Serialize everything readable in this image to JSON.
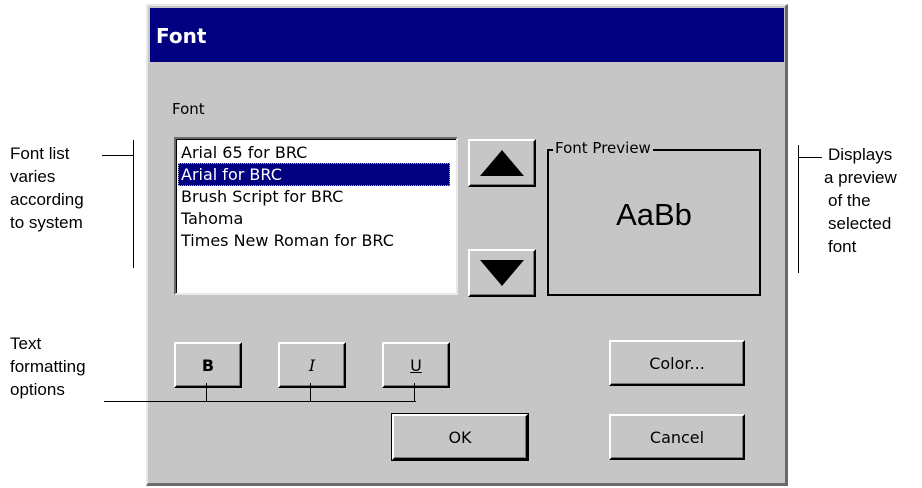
{
  "dialog": {
    "title": "Font",
    "font_label": "Font",
    "font_list": [
      "Arial 65 for BRC",
      "Arial for BRC",
      "Brush Script for BRC",
      "Tahoma",
      "Times New Roman for BRC"
    ],
    "selected_font_index": 1,
    "scroll_up_icon": "triangle-up-icon",
    "scroll_down_icon": "triangle-down-icon",
    "preview_label": "Font Preview",
    "preview_sample": "AaBb",
    "bold_label": "B",
    "italic_label": "I",
    "underline_label": "U",
    "color_label": "Color...",
    "ok_label": "OK",
    "cancel_label": "Cancel"
  },
  "annotations": {
    "font_list": "Font list varies according to system",
    "font_list_lines": [
      "Font list",
      "varies",
      "according",
      "to system"
    ],
    "preview": "Displays a preview of the selected font",
    "preview_lines": [
      "Displays",
      "a preview",
      "of the",
      "selected",
      "font"
    ],
    "formatting": "Text formatting options",
    "formatting_lines": [
      "Text",
      "formatting",
      "options"
    ]
  },
  "colors": {
    "title_bar": "#000080",
    "dialog_face": "#c6c6c6",
    "selection": "#000080"
  }
}
